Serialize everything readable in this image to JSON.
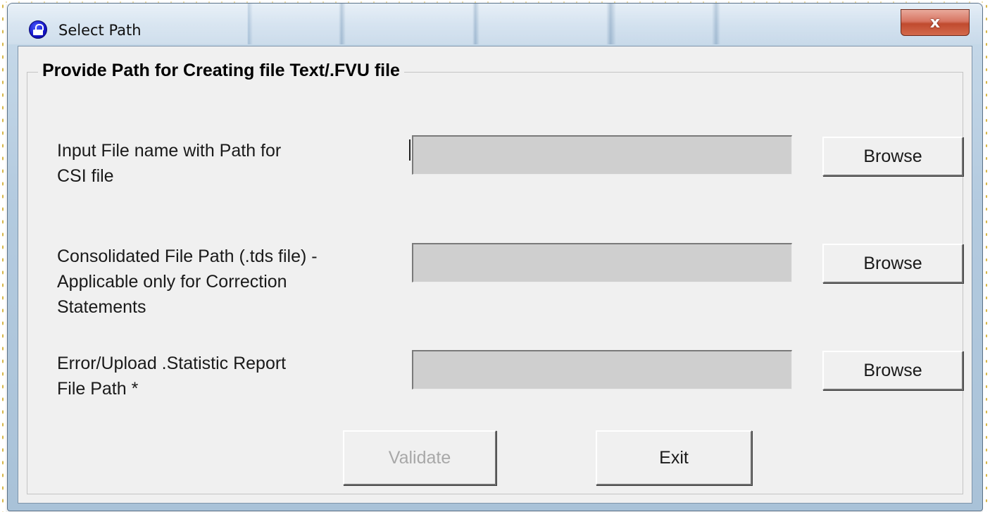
{
  "window": {
    "title": "Select Path",
    "close_label": "x"
  },
  "group": {
    "legend": "Provide Path for Creating file Text/.FVU file"
  },
  "fields": {
    "csi": {
      "label_line1": "Input File name with Path for",
      "label_line2": "CSI file",
      "value": "",
      "browse_label": "Browse"
    },
    "consolidated": {
      "label_line1": "Consolidated File Path (.tds file) -",
      "label_line2": "Applicable only for Correction",
      "label_line3": "Statements",
      "value": "",
      "browse_label": "Browse"
    },
    "error_report": {
      "label_line1": "Error/Upload .Statistic Report",
      "label_line2": "File Path *",
      "value": "",
      "browse_label": "Browse"
    }
  },
  "actions": {
    "validate_label": "Validate",
    "validate_enabled": false,
    "exit_label": "Exit"
  },
  "icons": {
    "app": "app-lock-icon",
    "close": "close-icon"
  }
}
